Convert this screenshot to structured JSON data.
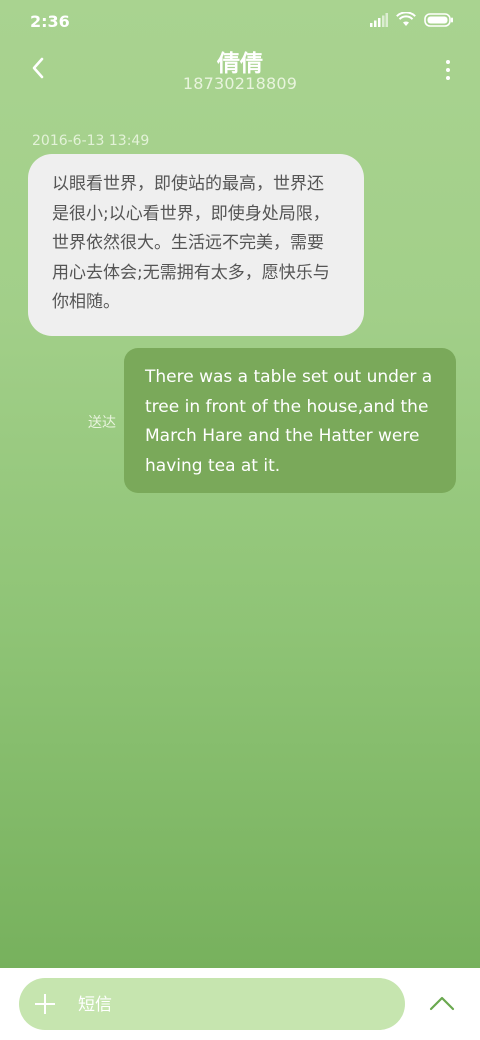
{
  "status_bar": {
    "time": "2:36"
  },
  "header": {
    "contact_name": "倩倩",
    "contact_number": "18730218809"
  },
  "conversation": {
    "timestamp": "2016-6-13 13:49",
    "incoming_message": "以眼看世界，即使站的最高，世界还是很小;以心看世界，即使身处局限，世界依然很大。生活远不完美，需要用心去体会;无需拥有太多，愿快乐与你相随。",
    "outgoing_message": "There was a table set out under a tree in front of the house,and the March Hare and the Hatter were having tea at it.",
    "outgoing_status": "送达"
  },
  "composer": {
    "placeholder": "短信"
  },
  "colors": {
    "background_top": "#a9d390",
    "background_bottom": "#72ad58",
    "incoming_bubble": "#efefef",
    "outgoing_bubble": "#7aa95a",
    "input_pill": "#c6e5af",
    "icon_accent": "#6aa84f"
  },
  "icons": {
    "back": "chevron-left-icon",
    "more": "more-vertical-icon",
    "signal": "signal-icon",
    "wifi": "wifi-icon",
    "battery": "battery-icon",
    "add": "plus-icon",
    "expand": "chevron-up-icon"
  }
}
